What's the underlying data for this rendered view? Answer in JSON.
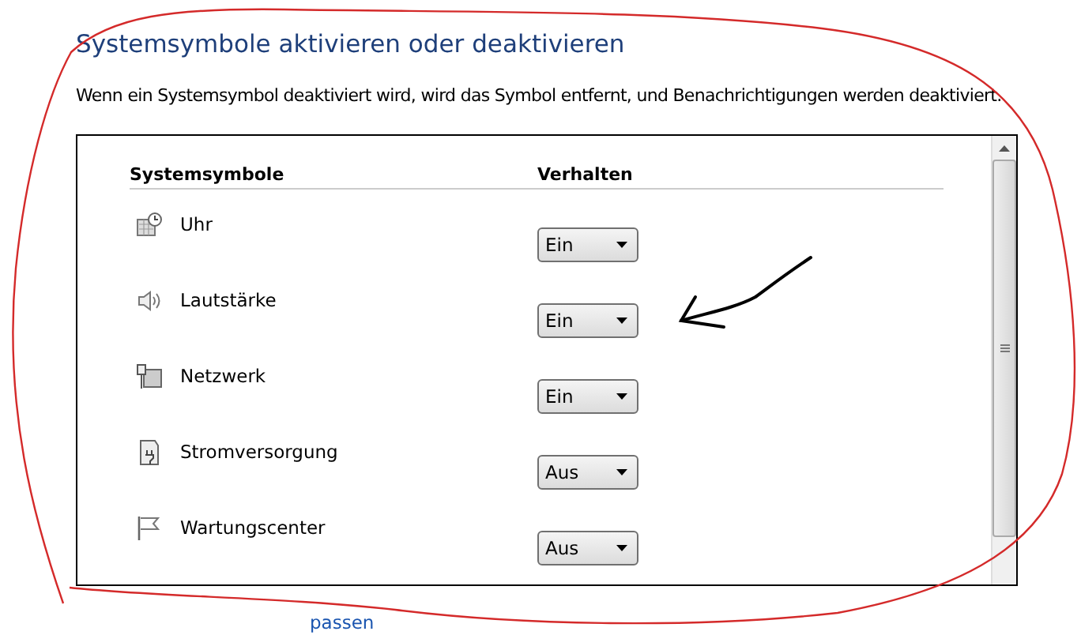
{
  "title": "Systemsymbole aktivieren oder deaktivieren",
  "description": "Wenn ein Systemsymbol deaktiviert wird, wird das Symbol entfernt, und Benachrichtigungen werden deaktiviert.",
  "table": {
    "columns": [
      "Systemsymbole",
      "Verhalten"
    ],
    "rows": [
      {
        "name": "Uhr",
        "behavior": "Ein"
      },
      {
        "name": "Lautstärke",
        "behavior": "Ein"
      },
      {
        "name": "Netzwerk",
        "behavior": "Ein"
      },
      {
        "name": "Stromversorgung",
        "behavior": "Aus"
      },
      {
        "name": "Wartungscenter",
        "behavior": "Aus"
      }
    ]
  },
  "link": "passen"
}
